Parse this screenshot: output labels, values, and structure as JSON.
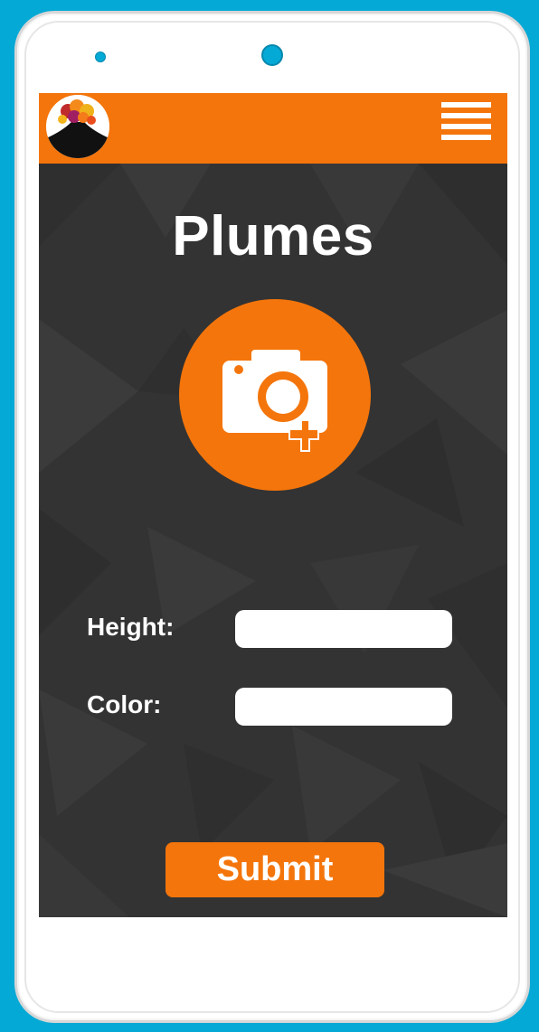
{
  "app": {
    "title": "Plumes"
  },
  "header": {
    "logo_icon": "volcano-plume-logo-icon",
    "menu_icon": "hamburger-menu-icon"
  },
  "photo": {
    "icon": "add-photo-camera-icon"
  },
  "form": {
    "height_label": "Height:",
    "height_value": "",
    "height_placeholder": "",
    "color_label": "Color:",
    "color_value": "",
    "color_placeholder": ""
  },
  "actions": {
    "submit_label": "Submit"
  },
  "colors": {
    "accent": "#f4750b",
    "screen_background": "#333333",
    "device_background": "#05a9d6",
    "text": "#ffffff"
  }
}
